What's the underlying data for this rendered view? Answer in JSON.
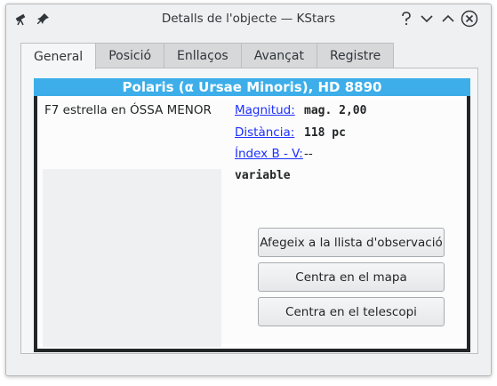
{
  "window": {
    "title": "Detalls de l'objecte — KStars"
  },
  "tabs": [
    {
      "label": "General",
      "active": true
    },
    {
      "label": "Posició",
      "active": false
    },
    {
      "label": "Enllaços",
      "active": false
    },
    {
      "label": "Avançat",
      "active": false
    },
    {
      "label": "Registre",
      "active": false
    }
  ],
  "object": {
    "name": "Polaris (α Ursae Minoris), HD 8890",
    "type_description": "F7 estrella en ÓSSA MENOR",
    "magnitude_label": "Magnitud:",
    "magnitude_value": "mag. 2,00",
    "distance_label": "Distància:",
    "distance_value": "118 pc",
    "bv_label": "Índex B - V:",
    "bv_value": "--",
    "multiplicity": "variable"
  },
  "actions": {
    "add_observing_list": "Afegeix a la llista d'observació",
    "center_map": "Centra en el mapa",
    "center_telescope": "Centra en el telescopi"
  },
  "colors": {
    "header_bar": "#3daee9",
    "link": "#1d31ff",
    "window_bg": "#eff0f1"
  },
  "icons": {
    "app": "kstars-telescope-icon",
    "pin": "pin-icon",
    "help": "help-icon",
    "minimize": "chevron-down-icon",
    "maximize": "chevron-up-icon",
    "close": "close-icon"
  }
}
